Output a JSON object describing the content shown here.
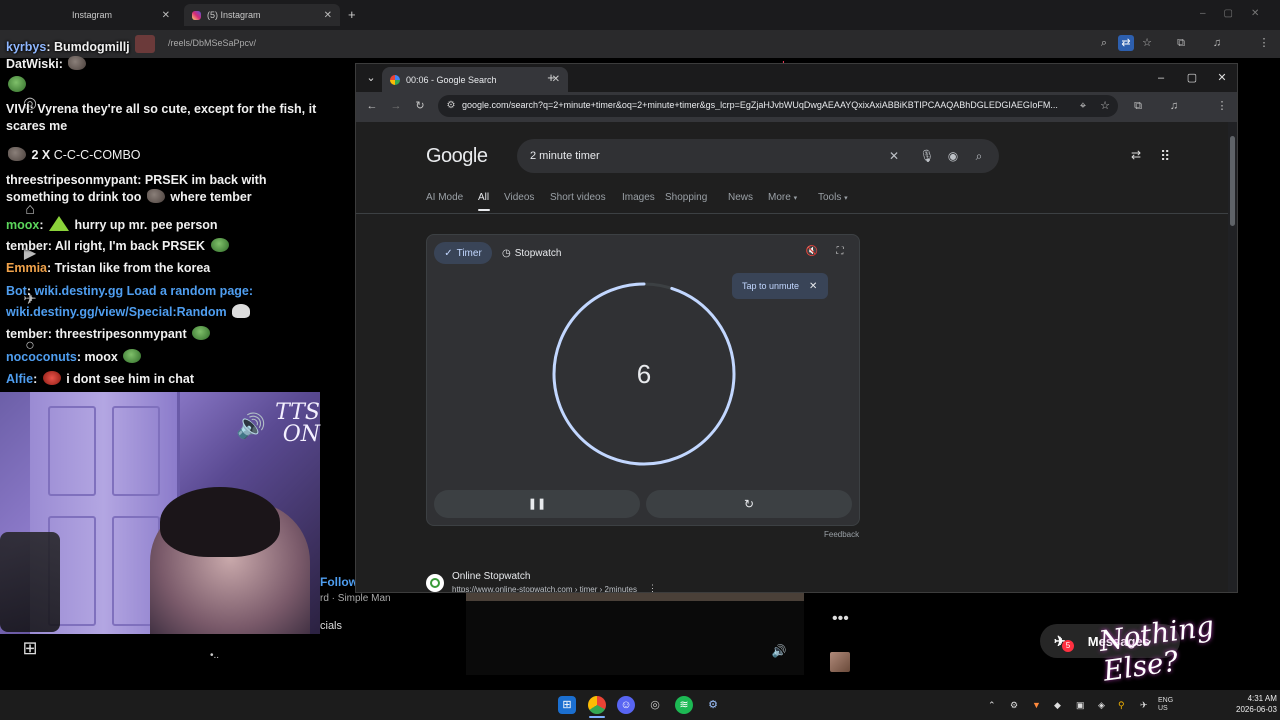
{
  "bg_browser": {
    "tabs": [
      {
        "label": "Instagram",
        "close": "✕"
      },
      {
        "label": "(5) Instagram",
        "close": "✕"
      }
    ],
    "new_tab": "+",
    "url": "/reels/DbMSeSaPpcv/"
  },
  "chat": {
    "messages": [
      {
        "user": "kyrbys",
        "user_color": "#8fb7ff",
        "text": "Bumdogmillj"
      },
      {
        "user": "DatWiski",
        "user_color": "#f0f0f0",
        "text": ""
      },
      {
        "user": "VIVI",
        "user_color": "#f0f0f0",
        "text": "Vyrena they're all so cute, except for the fish, it scares me"
      },
      {
        "user": "2 X",
        "user_color": "#f0f0f0",
        "text": "C-C-C-COMBO"
      },
      {
        "user": "threestripesonmypant",
        "user_color": "#f0f0f0",
        "text": "PRSEK im back with something to drink too",
        "extra": "where tember"
      },
      {
        "user": "moox",
        "user_color": "#5cd65c",
        "text": "hurry up mr. pee person"
      },
      {
        "user": "tember",
        "user_color": "#f0f0f0",
        "text": "All right, I'm back PRSEK"
      },
      {
        "user": "Emmia",
        "user_color": "#f0a24a",
        "text": "Tristan like from the korea"
      },
      {
        "user": "Bot",
        "user_color": "#4f9ef0",
        "text": "wiki.destiny.gg Load a random page:",
        "link": "wiki.destiny.gg/view/Special:Random"
      },
      {
        "user": "tember",
        "user_color": "#f0f0f0",
        "text": "threestripesonmypant"
      },
      {
        "user": "nococonuts",
        "user_color": "#4f9ef0",
        "text": "moox"
      },
      {
        "user": "Alfie",
        "user_color": "#4f9ef0",
        "text": "i dont see him in chat"
      }
    ]
  },
  "overlay": {
    "tts_line1": "TTS",
    "tts_line2": "ON",
    "nothing_else": "Nothing Else?"
  },
  "bg_page": {
    "follow": "Follow",
    "song": "rd · Simple Man",
    "cials": "cials",
    "ellipsis": "•..",
    "more": "•••",
    "messages_label": "Messages",
    "messages_badge": "5"
  },
  "chrome": {
    "tab_title": "00:06 - Google Search",
    "tab_close": "✕",
    "new_tab": "+",
    "url": "google.com/search?q=2+minute+timer&oq=2+minute+timer&gs_lcrp=EgZjaHJvbWUqDwgAEAAYQxixAxiABBiKBTIPCAAQABhDGLEDGIAEGIoFM..."
  },
  "google": {
    "logo": "Google",
    "query": "2 minute timer",
    "tabs": [
      "AI Mode",
      "All",
      "Videos",
      "Short videos",
      "Images",
      "Shopping",
      "News",
      "More",
      "Tools"
    ],
    "active_tab": "All",
    "timer_chip": "Timer",
    "stopwatch_chip": "Stopwatch",
    "tooltip": "Tap to unmute",
    "tooltip_close": "✕",
    "timer_value": "6",
    "timer_progress": 0.95,
    "pause": "❚❚",
    "reset": "↻",
    "feedback": "Feedback",
    "result_title": "Online Stopwatch",
    "result_url": "https://www.online-stopwatch.com › timer › 2minutes",
    "result_kebab": "⋮"
  },
  "taskbar": {
    "lang_top": "ENG",
    "lang_bottom": "US",
    "time": "4:31 AM",
    "date": "2026-06-03"
  },
  "colors": {
    "accent_blue": "#8ab4f8",
    "ring": "#c2d7ff",
    "chip_bg": "#394457"
  }
}
